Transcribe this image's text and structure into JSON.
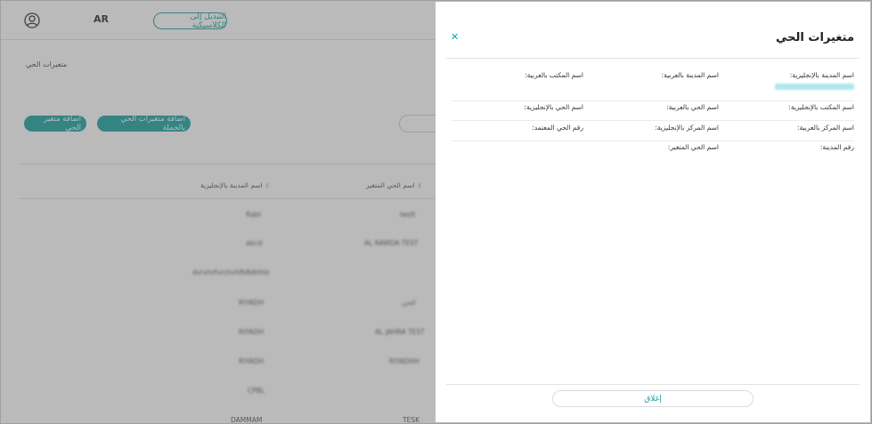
{
  "header": {
    "user_icon": "user-circle-icon",
    "lang_label": "AR",
    "classic_switch_label": "التبديل إلى الكلاسيكية"
  },
  "page": {
    "breadcrumb": "متغيرات الحي",
    "bulk_add_label": "اضافة متغيرات الحي بالجملة",
    "add_label": "اضافة متغير الحي"
  },
  "table": {
    "columns": [
      "اسم الحي المتغير",
      "اسم المدينة بالإنجليزية"
    ],
    "rows": [
      [
        "testt",
        "Rabt"
      ],
      [
        "AL RAWDA TEST",
        "abcd"
      ],
      [
        "",
        "dvrvhrfvrchvhfb8dkthb"
      ],
      [
        "الحي",
        "RIYADH"
      ],
      [
        "AL JAHRA TEST",
        "RIYADH"
      ],
      [
        "RIYADHH",
        "RIYADH"
      ],
      [
        "",
        "CPBL"
      ],
      [
        "TESK",
        "DAMMAM"
      ]
    ]
  },
  "drawer": {
    "title": "متغيرات الحي",
    "close_icon": "close-icon",
    "fields": {
      "city_en": "اسم المدينة بالإنجليزية:",
      "city_ar": "اسم المدينة بالعربية:",
      "office_ar": "اسم المكتب بالعربية:",
      "office_en": "اسم المكتب بالإنجليزية:",
      "district_ar": "اسم الحي بالعربية:",
      "district_en": "اسم الحي بالإنجليزية:",
      "center_ar": "اسم المركز بالعربية:",
      "center_en": "اسم المركز بالإنجليزية:",
      "approved_district_no": "رقم الحي المعتمد:",
      "city_no": "رقم المدينة:",
      "variant_district_name": "اسم الحي المتغير:"
    },
    "close_button_label": "إغلاق"
  },
  "colors": {
    "accent": "#19a3a3",
    "overlay": "#5a5a5a"
  }
}
